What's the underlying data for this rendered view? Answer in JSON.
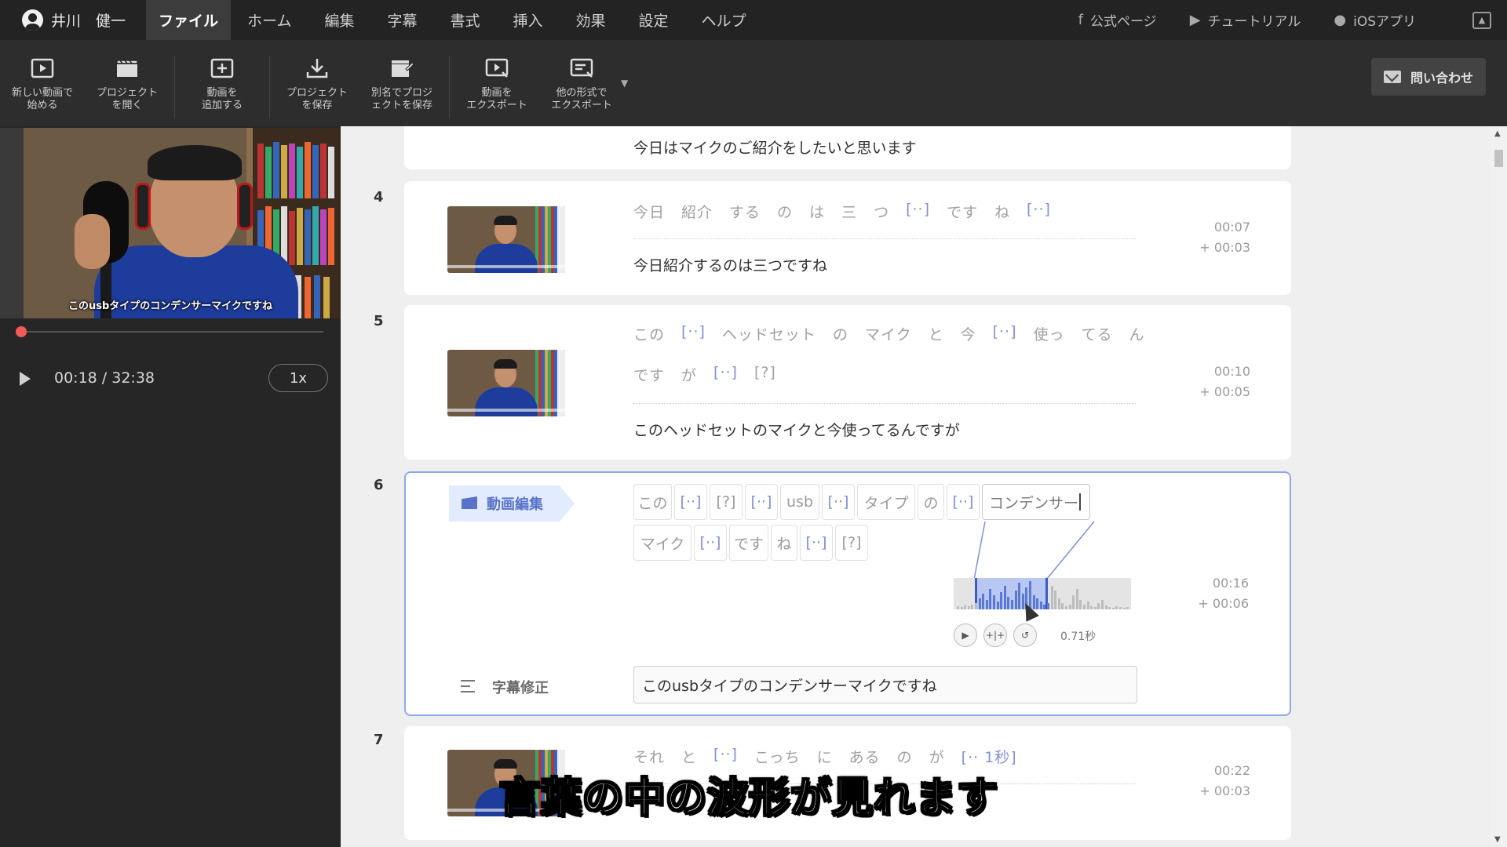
{
  "menubar": {
    "user_name": "井川　健一",
    "items": [
      "ファイル",
      "ホーム",
      "編集",
      "字幕",
      "書式",
      "挿入",
      "効果",
      "設定",
      "ヘルプ"
    ],
    "active_item": "ファイル",
    "links": [
      {
        "label": "公式ページ",
        "icon": "facebook-icon"
      },
      {
        "label": "チュートリアル",
        "icon": "youtube-icon"
      },
      {
        "label": "iOSアプリ",
        "icon": "apple-icon"
      }
    ]
  },
  "toolbar": {
    "tools": [
      {
        "line1": "新しい動画で",
        "line2": "始める",
        "icon": "new-video-icon"
      },
      {
        "line1": "プロジェクト",
        "line2": "を開く",
        "icon": "open-project-icon"
      },
      {
        "line1": "動画を",
        "line2": "追加する",
        "icon": "add-video-icon"
      },
      {
        "line1": "プロジェクト",
        "line2": "を保存",
        "icon": "save-project-icon"
      },
      {
        "line1": "別名でプロジ",
        "line2": "ェクトを保存",
        "icon": "save-as-icon"
      },
      {
        "line1": "動画を",
        "line2": "エクスポート",
        "icon": "export-video-icon"
      },
      {
        "line1": "他の形式で",
        "line2": "エクスポート",
        "icon": "export-other-icon"
      }
    ],
    "contact_label": "問い合わせ"
  },
  "player": {
    "video_caption": "このusbタイプのコンデンサーマイクですね",
    "time": "00:18 / 32:38",
    "speed": "1x",
    "progress": 0.009
  },
  "rows": {
    "top_subtitle": "今日はマイクのご紹介をしたいと思います",
    "r4": {
      "num": "4",
      "words": [
        "今日",
        "紹介",
        "する",
        "の",
        "は",
        "三",
        "つ",
        "[··]",
        "です",
        "ね",
        "[··]"
      ],
      "subtitle": "今日紹介するのは三つですね",
      "start": "00:07",
      "dur": "+ 00:03"
    },
    "r5": {
      "num": "5",
      "words_line1": [
        "この",
        "[··]",
        "ヘッドセット",
        "の",
        "マイク",
        "と",
        "今",
        "[··]",
        "使っ",
        "てる",
        "ん"
      ],
      "words_line2": [
        "です",
        "が",
        "[··]",
        "[?]"
      ],
      "subtitle": "このヘッドセットのマイクと今使ってるんですが",
      "start": "00:10",
      "dur": "+ 00:05"
    },
    "r6": {
      "num": "6",
      "tag": "動画編集",
      "chips": [
        "この",
        "[··]",
        "[?]",
        "[··]",
        "usb",
        "[··]",
        "タイプ",
        "の",
        "[··]",
        "コンデンサー",
        "マイク",
        "[··]",
        "です",
        "ね",
        "[··]",
        "[?]"
      ],
      "wave_seconds": "0.71秒",
      "fix_label": "字幕修正",
      "fix_value": "このusbタイプのコンデンサーマイクですね",
      "start": "00:16",
      "dur": "+ 00:06"
    },
    "r7": {
      "num": "7",
      "words": [
        "それ",
        "と",
        "[··]",
        "こっち",
        "に",
        "ある",
        "の",
        "が",
        "[·· 1秒]"
      ],
      "start": "00:22",
      "dur": "+ 00:03"
    }
  },
  "overlay_caption": "言葉の中の波形が見れます"
}
